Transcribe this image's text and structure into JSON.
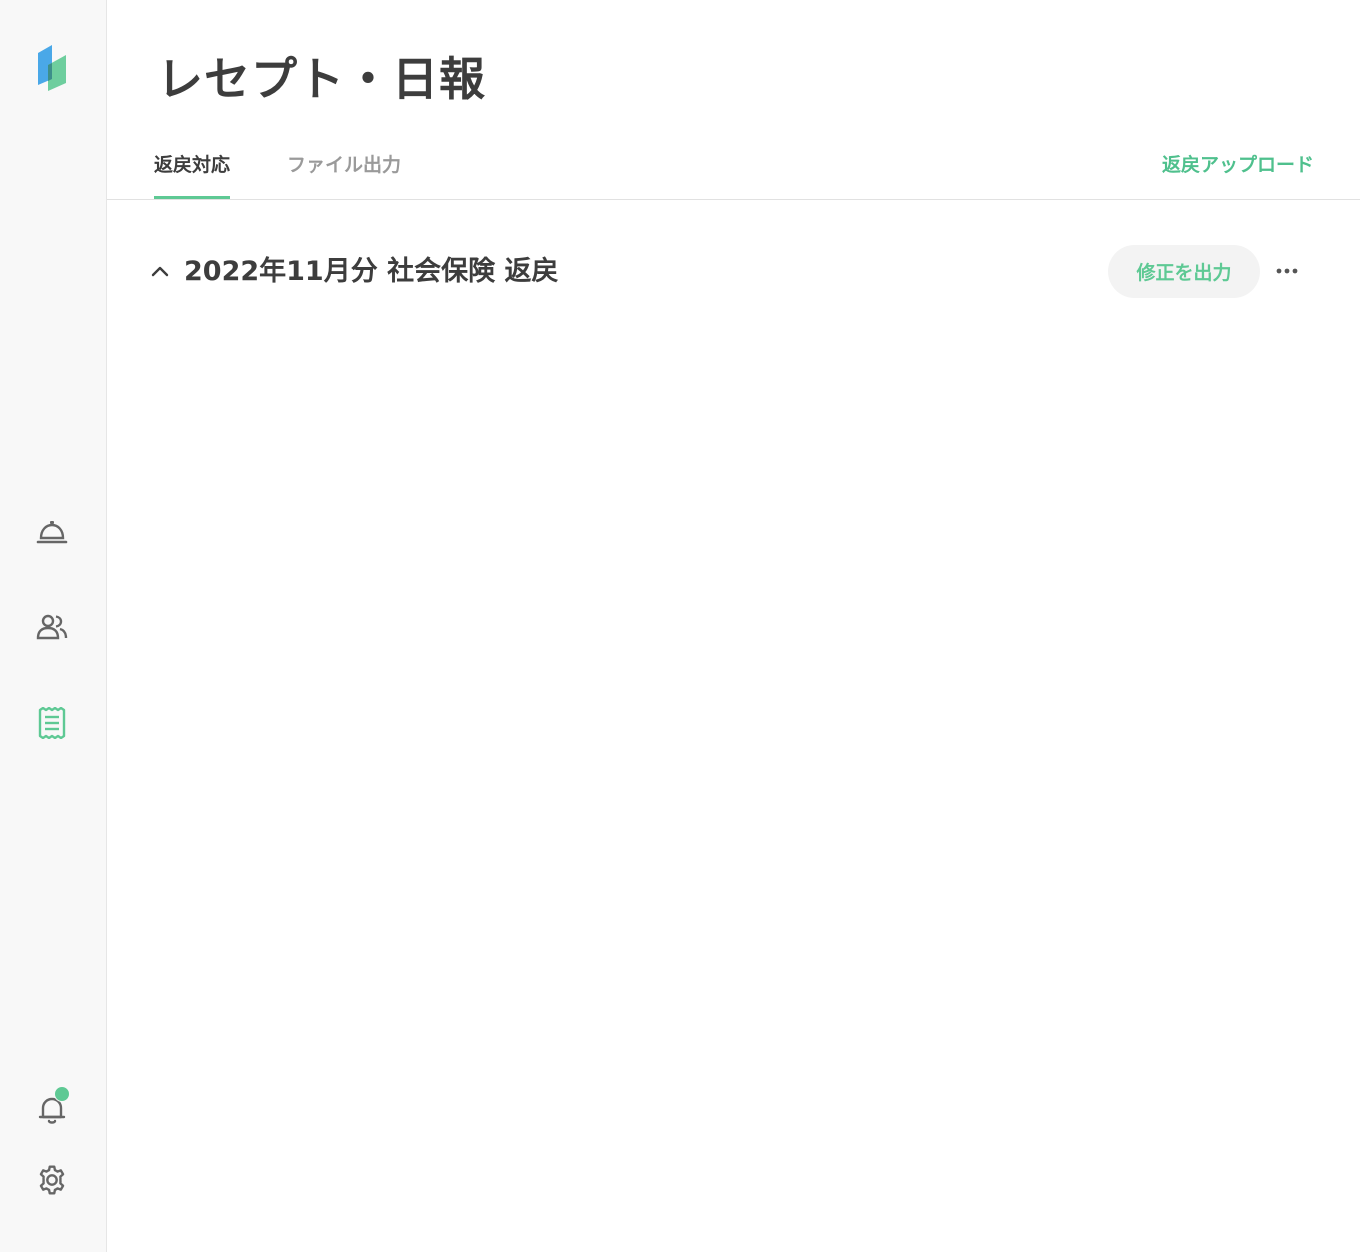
{
  "page": {
    "title": "レセプト・日報"
  },
  "tabs": [
    {
      "label": "返戻対応",
      "active": true
    },
    {
      "label": "ファイル出力",
      "active": false
    }
  ],
  "actions": {
    "upload_label": "返戻アップロード"
  },
  "section": {
    "title": "2022年11月分 社会保険 返戻",
    "export_label": "修正を出力",
    "expanded": true
  },
  "sidebar": {
    "items": [
      {
        "icon": "service-bell-icon",
        "active": false
      },
      {
        "icon": "people-icon",
        "active": false
      },
      {
        "icon": "receipt-icon",
        "active": true
      }
    ],
    "bottom": [
      {
        "icon": "bell-icon",
        "has_badge": true
      },
      {
        "icon": "gear-icon"
      }
    ]
  },
  "colors": {
    "accent": "#5ec994",
    "logo_blue": "#4aa8e8",
    "icon_gray": "#666666"
  }
}
